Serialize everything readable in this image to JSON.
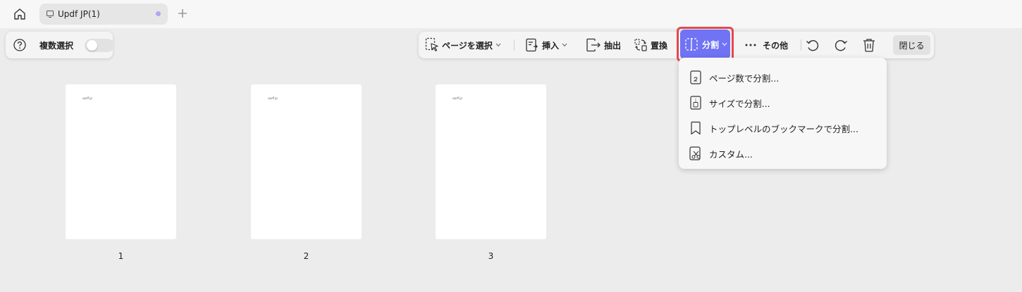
{
  "tabs": {
    "home_icon": "home-icon",
    "document_title": "Updf JP(1)",
    "document_icon": "document-icon",
    "unsaved_dot_color": "#b3a6ee",
    "new_tab_icon": "plus-icon"
  },
  "multi_select": {
    "help_icon": "question-icon",
    "label": "複数選択",
    "enabled": false
  },
  "toolbar": {
    "select_page": "ページを選択",
    "insert": "挿入",
    "extract": "抽出",
    "replace": "置換",
    "split": "分割",
    "more": "その他",
    "close": "閉じる",
    "icons": [
      "cursor-select-icon",
      "insert-icon",
      "extract-icon",
      "replace-icon",
      "split-icon",
      "ellipsis-icon",
      "rotate-left-icon",
      "rotate-right-icon",
      "trash-icon"
    ],
    "active_color": "#6f73f4",
    "highlight_color": "#e5484d"
  },
  "split_menu": {
    "items": [
      {
        "label": "ページ数で分割...",
        "icon": "page-count-icon"
      },
      {
        "label": "サイズで分割...",
        "icon": "file-size-icon"
      },
      {
        "label": "トップレベルのブックマークで分割...",
        "icon": "bookmark-icon"
      },
      {
        "label": "カスタム...",
        "icon": "scissors-page-icon"
      }
    ]
  },
  "pages": [
    {
      "number": "1",
      "mini_text": "updf jp"
    },
    {
      "number": "2",
      "mini_text": "updf jp"
    },
    {
      "number": "3",
      "mini_text": "updf jp"
    }
  ]
}
